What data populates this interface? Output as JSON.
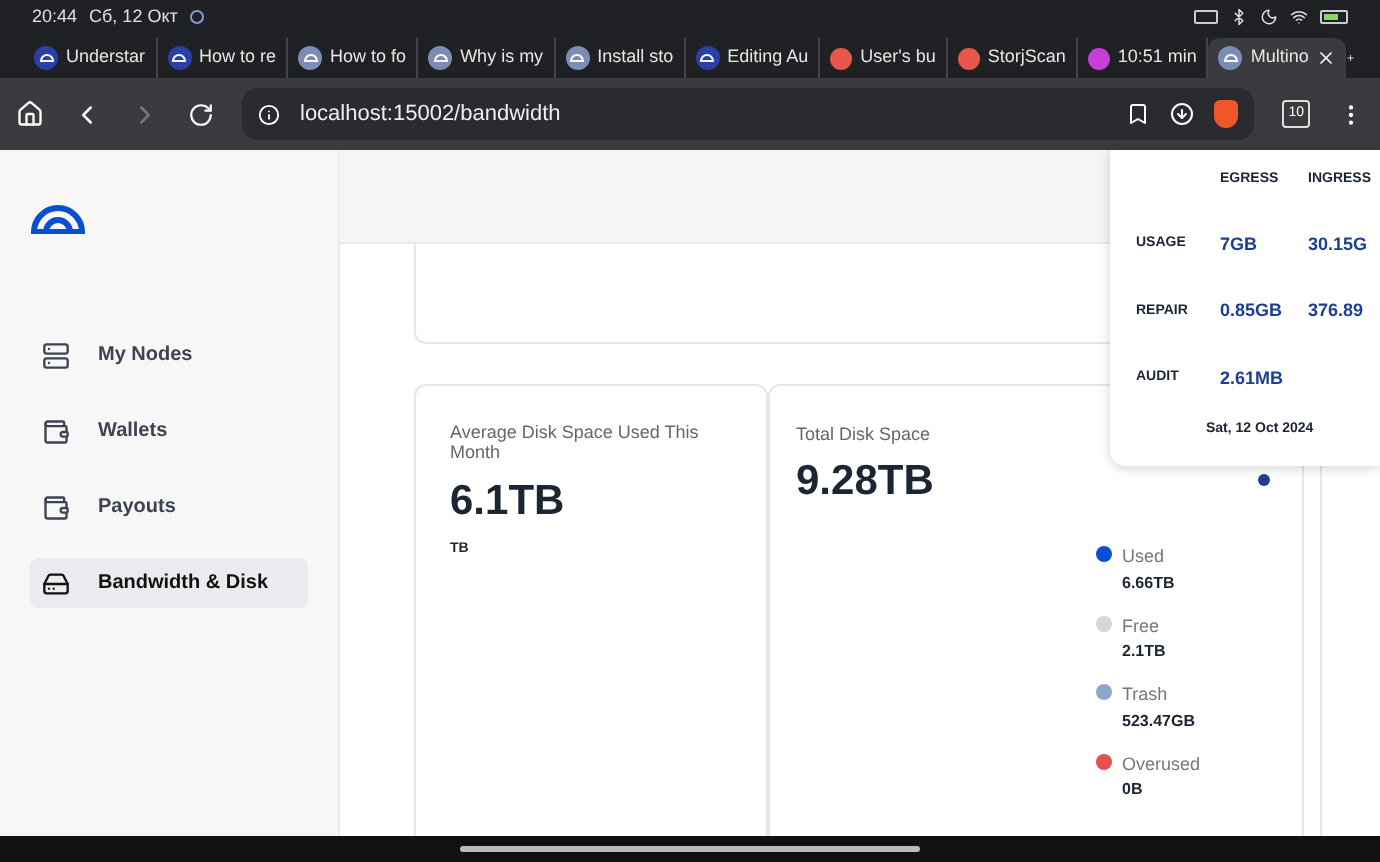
{
  "status_bar": {
    "time": "20:44",
    "date": "Сб, 12 Окт"
  },
  "browser_tabs": [
    {
      "kind": "storj",
      "label": "Understar",
      "selected": false
    },
    {
      "kind": "storj",
      "label": "How to re",
      "selected": false
    },
    {
      "kind": "storj-gray",
      "label": "How to fo",
      "selected": false
    },
    {
      "kind": "storj-gray",
      "label": "Why is my",
      "selected": false
    },
    {
      "kind": "storj-gray",
      "label": "Install sto",
      "selected": false
    },
    {
      "kind": "storj",
      "label": "Editing Au",
      "selected": false
    },
    {
      "kind": "forum",
      "label": "User's bu",
      "selected": false
    },
    {
      "kind": "forum",
      "label": "StorjScan",
      "selected": false
    },
    {
      "kind": "timer",
      "label": "10:51 min",
      "selected": false
    },
    {
      "kind": "storj-gray",
      "label": "Multino",
      "selected": true
    }
  ],
  "address_bar": {
    "url": "localhost:15002/bandwidth",
    "tab_count": "10"
  },
  "sidebar": {
    "items": [
      {
        "kind": "nodes",
        "label": "My Nodes",
        "selected": false
      },
      {
        "kind": "wallet",
        "label": "Wallets",
        "selected": false
      },
      {
        "kind": "wallet",
        "label": "Payouts",
        "selected": false
      },
      {
        "kind": "disk",
        "label": "Bandwidth & Disk",
        "selected": true
      }
    ]
  },
  "avg_disk_card": {
    "title": "Average Disk Space Used This Month",
    "value": "6.1TB",
    "unit": "TB"
  },
  "total_disk_card": {
    "title": "Total Disk Space",
    "value": "9.28TB",
    "legend": [
      {
        "label": "Used",
        "value": "6.66TB",
        "color": "#0b4fd1"
      },
      {
        "label": "Free",
        "value": "2.1TB",
        "color": "#d6d6d6"
      },
      {
        "label": "Trash",
        "value": "523.47GB",
        "color": "#8ea6cc"
      },
      {
        "label": "Overused",
        "value": "0B",
        "color": "#e45050"
      }
    ]
  },
  "tooltip": {
    "columns": [
      "EGRESS",
      "INGRESS"
    ],
    "rows": [
      {
        "label": "USAGE",
        "values": [
          "7GB",
          "30.15G"
        ]
      },
      {
        "label": "REPAIR",
        "values": [
          "0.85GB",
          "376.89"
        ]
      },
      {
        "label": "AUDIT",
        "values": [
          "2.61MB"
        ]
      }
    ],
    "date": "Sat, 12 Oct 2024"
  }
}
